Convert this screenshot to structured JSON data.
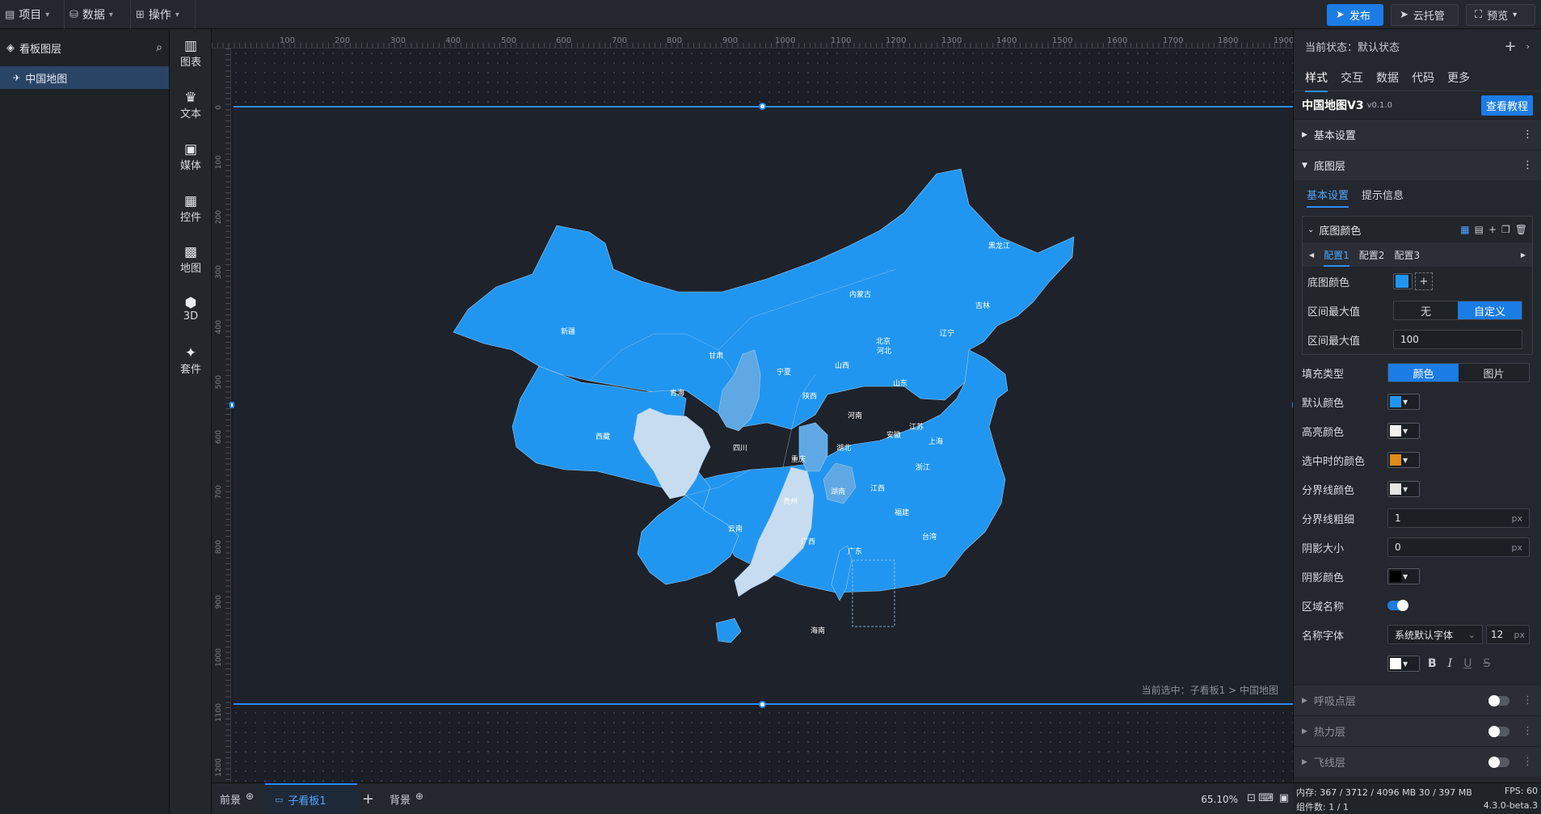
{
  "topbar": {
    "menus": [
      {
        "icon": "file-icon",
        "label": "项目"
      },
      {
        "icon": "database-icon",
        "label": "数据"
      },
      {
        "icon": "grid-icon",
        "label": "操作"
      }
    ],
    "publish_label": "发布",
    "cloud_label": "云托管",
    "preview_label": "预览"
  },
  "layers": {
    "title": "看板图层",
    "items": [
      {
        "label": "中国地图"
      }
    ]
  },
  "toolbox": {
    "items": [
      {
        "label": "图表",
        "icon": "bar-chart-icon"
      },
      {
        "label": "文本",
        "icon": "crown-icon"
      },
      {
        "label": "媒体",
        "icon": "media-icon"
      },
      {
        "label": "控件",
        "icon": "control-icon"
      },
      {
        "label": "地图",
        "icon": "map-icon"
      },
      {
        "label": "3D",
        "icon": "cube-icon"
      },
      {
        "label": "套件",
        "icon": "kit-icon"
      }
    ]
  },
  "ruler": {
    "top_ticks": [
      "100",
      "200",
      "300",
      "400",
      "500",
      "600",
      "700",
      "800",
      "900",
      "1000",
      "1100",
      "1200",
      "1300",
      "1400",
      "1500",
      "1600",
      "1700",
      "1800",
      "1900"
    ],
    "left_ticks": [
      "0",
      "100",
      "200",
      "300",
      "400",
      "500",
      "600",
      "700",
      "800",
      "900",
      "1000",
      "1100",
      "1200"
    ]
  },
  "map": {
    "colors": {
      "default": "#2196f0",
      "light": "#c8dcef",
      "mid": "#5fa8e4",
      "highlight": "#f0f0f0",
      "selected": "#e08a17"
    },
    "provinces": [
      "新疆",
      "西藏",
      "青海",
      "甘肃",
      "内蒙古",
      "黑龙江",
      "吉林",
      "辽宁",
      "北京",
      "河北",
      "山西",
      "宁夏",
      "陕西",
      "四川",
      "重庆",
      "湖北",
      "河南",
      "山东",
      "江苏",
      "安徽",
      "上海",
      "浙江",
      "江西",
      "福建",
      "湖南",
      "贵州",
      "云南",
      "广西",
      "广东",
      "台湾",
      "海南"
    ]
  },
  "canvas": {
    "breadcrumb": "当前选中：子看板1 > 中国地图"
  },
  "bottombar": {
    "tabs": [
      "前景",
      "子看板1",
      "背景"
    ],
    "zoom": "65.10%"
  },
  "panel": {
    "state_label": "当前状态：默认状态",
    "tabs": [
      "样式",
      "交互",
      "数据",
      "代码",
      "更多"
    ],
    "component_name": "中国地图V3",
    "component_version": "v0.1.0",
    "tutorial_label": "查看教程",
    "sections": {
      "basic": "基本设置",
      "base_layer": "底图层",
      "breath": "呼吸点层",
      "heat": "热力层",
      "flyline": "飞线层"
    },
    "subtabs": [
      "基本设置",
      "提示信息"
    ],
    "base_color_group": "底图颜色",
    "configs": [
      "配置1",
      "配置2",
      "配置3"
    ],
    "inner_rows": {
      "base_color": "底图颜色",
      "range_max": "区间最大值",
      "range_options": [
        "无",
        "自定义"
      ],
      "range_max_value_label": "区间最大值",
      "range_max_value": "100"
    },
    "fill_type_label": "填充类型",
    "fill_options": [
      "颜色",
      "图片"
    ],
    "default_color_label": "默认颜色",
    "highlight_color_label": "高亮颜色",
    "selected_color_label": "选中时的颜色",
    "border_color_label": "分界线颜色",
    "border_width_label": "分界线粗细",
    "border_width_value": "1",
    "shadow_size_label": "阴影大小",
    "shadow_size_value": "0",
    "shadow_color_label": "阴影颜色",
    "region_name_label": "区域名称",
    "name_font_label": "名称字体",
    "font_value": "系统默认字体",
    "font_size_value": "12",
    "unit_px": "px"
  },
  "status": {
    "memory": "内存:  367 / 3712 / 4096 MB  30 / 397 MB",
    "fps": "FPS: 60",
    "components": "组件数: 1 / 1",
    "version": "4.3.0-beta.3"
  }
}
